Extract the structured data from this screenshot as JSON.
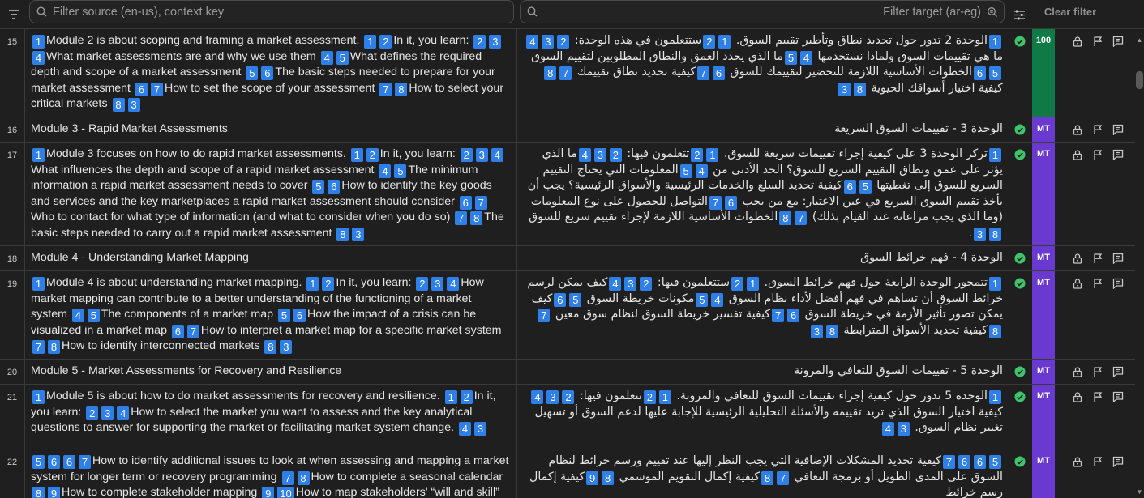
{
  "toolbar": {
    "source_filter_placeholder": "Filter source (en-us), context key",
    "target_filter_placeholder": "Filter target (ar-eg)",
    "clear_filter_label": "Clear filter"
  },
  "colors": {
    "tag": "#2f7fe8",
    "check": "#3ec56b",
    "badge_100": "#0f7a46",
    "badge_mt": "#6a3ad0"
  },
  "rows": [
    {
      "num": "15",
      "badge": "100",
      "source": [
        {
          "g": "1"
        },
        {
          "t": "Module 2 is about scoping and framing a market assessment. "
        },
        {
          "g": "1"
        },
        {
          "g": "2"
        },
        {
          "t": "In it, you learn: "
        },
        {
          "g": "2"
        },
        {
          "g": "3"
        },
        {
          "g": "4"
        },
        {
          "t": "What market assessments are and why we use them "
        },
        {
          "g": "4"
        },
        {
          "g": "5"
        },
        {
          "t": "What defines the required depth and scope of a market assessment "
        },
        {
          "g": "5"
        },
        {
          "g": "6"
        },
        {
          "t": "The basic steps needed to prepare for your market assessment  "
        },
        {
          "g": "6"
        },
        {
          "g": "7"
        },
        {
          "t": "How to set the scope of your assessment "
        },
        {
          "g": "7"
        },
        {
          "g": "8"
        },
        {
          "t": "How to select your critical markets  "
        },
        {
          "g": "8"
        },
        {
          "g": "3"
        }
      ],
      "target": [
        {
          "g": "1"
        },
        {
          "t": "الوحدة 2 تدور حول تحديد نطاق وتأطير تقييم السوق. "
        },
        {
          "g": "1"
        },
        {
          "g": "2"
        },
        {
          "t": "ستتعلمون في هذه الوحدة: "
        },
        {
          "g": "2"
        },
        {
          "g": "3"
        },
        {
          "g": "4"
        },
        {
          "t": "ما هي تقييمات السوق ولماذا نستخدمها "
        },
        {
          "g": "4"
        },
        {
          "g": "5"
        },
        {
          "t": "ما الذي يحدد العمق والنطاق المطلوبين لتقييم السوق "
        },
        {
          "g": "5"
        },
        {
          "g": "6"
        },
        {
          "t": "الخطوات الأساسية اللازمة للتحضير لتقييمك للسوق "
        },
        {
          "g": "6"
        },
        {
          "g": "7"
        },
        {
          "t": "كيفية تحديد نطاق تقييمك "
        },
        {
          "g": "7"
        },
        {
          "g": "8"
        },
        {
          "t": "كيفية اختيار أسواقك الحيوية "
        },
        {
          "g": "8"
        },
        {
          "g": "3"
        }
      ]
    },
    {
      "num": "16",
      "badge": "MT",
      "source": [
        {
          "t": "Module 3 - Rapid Market Assessments"
        }
      ],
      "target": [
        {
          "t": "الوحدة 3 - تقييمات السوق السريعة"
        }
      ]
    },
    {
      "num": "17",
      "badge": "MT",
      "source": [
        {
          "g": "1"
        },
        {
          "t": "Module 3 focuses on how to do rapid market assessments. "
        },
        {
          "g": "1"
        },
        {
          "g": "2"
        },
        {
          "t": "In it, you learn: "
        },
        {
          "g": "2"
        },
        {
          "g": "3"
        },
        {
          "g": "4"
        },
        {
          "t": "What influences the depth and scope of a rapid market assessment  "
        },
        {
          "g": "4"
        },
        {
          "g": "5"
        },
        {
          "t": "The minimum information a rapid market assessment needs to cover  "
        },
        {
          "g": "5"
        },
        {
          "g": "6"
        },
        {
          "t": "How to identify the key goods and services and the key marketplaces a rapid market assessment should consider  "
        },
        {
          "g": "6"
        },
        {
          "g": "7"
        },
        {
          "t": "Who to contact for what type of information (and what to consider when you do so) "
        },
        {
          "g": "7"
        },
        {
          "g": "8"
        },
        {
          "t": "The basic steps needed to carry out a rapid market assessment  "
        },
        {
          "g": "8"
        },
        {
          "g": "3"
        }
      ],
      "target": [
        {
          "g": "1"
        },
        {
          "t": "تركز الوحدة 3 على كيفية إجراء تقييمات سريعة للسوق. "
        },
        {
          "g": "1"
        },
        {
          "g": "2"
        },
        {
          "t": "تتعلمون فيها: "
        },
        {
          "g": "2"
        },
        {
          "g": "3"
        },
        {
          "g": "4"
        },
        {
          "t": "ما الذي يؤثر على عمق ونطاق التقييم السريع للسوق؟ "
        },
        {
          "t": "الحد الأدنى من "
        },
        {
          "g": "4"
        },
        {
          "g": "5"
        },
        {
          "t": "المعلومات التي يحتاج التقييم السريع للسوق إلى تغطيتها "
        },
        {
          "g": "5"
        },
        {
          "g": "6"
        },
        {
          "t": "كيفية تحديد السلع والخدمات الرئيسية والأسواق الرئيسية؟ يجب أن يأخذ تقييم السوق السريع في عين الاعتبار: مع من يجب "
        },
        {
          "g": "6"
        },
        {
          "g": "7"
        },
        {
          "t": "التواصل للحصول على نوع المعلومات (وما الذي يجب مراعاته عند القيام بذلك) "
        },
        {
          "g": "7"
        },
        {
          "g": "8"
        },
        {
          "t": "الخطوات الأساسية اللازمة لإجراء تقييم سريع للسوق "
        },
        {
          "g": "8"
        },
        {
          "g": "3"
        },
        {
          "t": "."
        }
      ]
    },
    {
      "num": "18",
      "badge": "MT",
      "source": [
        {
          "t": "Module 4 - Understanding Market Mapping"
        }
      ],
      "target": [
        {
          "t": "الوحدة 4 - فهم خرائط السوق"
        }
      ]
    },
    {
      "num": "19",
      "badge": "MT",
      "source": [
        {
          "g": "1"
        },
        {
          "t": "Module 4 is about understanding market mapping. "
        },
        {
          "g": "1"
        },
        {
          "g": "2"
        },
        {
          "t": "In it, you learn: "
        },
        {
          "g": "2"
        },
        {
          "g": "3"
        },
        {
          "g": "4"
        },
        {
          "t": "How market mapping can contribute to a better understanding of the functioning of a market system "
        },
        {
          "g": "4"
        },
        {
          "g": "5"
        },
        {
          "t": "The components of a market map  "
        },
        {
          "g": "5"
        },
        {
          "g": "6"
        },
        {
          "t": "How the impact of a crisis can be visualized in a market map  "
        },
        {
          "g": "6"
        },
        {
          "g": "7"
        },
        {
          "t": "How to interpret a market map for a specific market system  "
        },
        {
          "g": "7"
        },
        {
          "g": "8"
        },
        {
          "t": "How to identify interconnected markets "
        },
        {
          "g": "8"
        },
        {
          "g": "3"
        }
      ],
      "target": [
        {
          "g": "1"
        },
        {
          "t": "تتمحور الوحدة الرابعة حول فهم خرائط السوق. "
        },
        {
          "g": "1"
        },
        {
          "g": "2"
        },
        {
          "t": "ستتعلمون فيها: "
        },
        {
          "g": "2"
        },
        {
          "g": "3"
        },
        {
          "g": "4"
        },
        {
          "t": "كيف يمكن لرسم خرائط السوق أن تساهم في فهم أفضل لأداء نظام السوق "
        },
        {
          "g": "4"
        },
        {
          "g": "5"
        },
        {
          "t": "مكونات خريطة السوق "
        },
        {
          "g": "5"
        },
        {
          "g": "6"
        },
        {
          "t": "كيف يمكن تصور تأثير الأزمة في خريطة السوق "
        },
        {
          "g": "6"
        },
        {
          "g": "7"
        },
        {
          "t": "كيفية تفسير خريطة السوق لنظام سوق معين "
        },
        {
          "g": "7"
        },
        {
          "g": "8"
        },
        {
          "t": "كيفية تحديد الأسواق المترابطة "
        },
        {
          "g": "8"
        },
        {
          "g": "3"
        }
      ]
    },
    {
      "num": "20",
      "badge": "MT",
      "source": [
        {
          "t": "Module 5 - Market Assessments for Recovery and Resilience"
        }
      ],
      "target": [
        {
          "t": "الوحدة 5 - تقييمات السوق للتعافي والمرونة"
        }
      ]
    },
    {
      "num": "21",
      "badge": "MT",
      "source": [
        {
          "g": "1"
        },
        {
          "t": "Module 5 is about how to do market assessments for recovery and resilience. "
        },
        {
          "g": "1"
        },
        {
          "g": "2"
        },
        {
          "t": "In it, you learn: "
        },
        {
          "g": "2"
        },
        {
          "g": "3"
        },
        {
          "g": "4"
        },
        {
          "t": "How to select the market you want to assess and the key analytical questions to answer for supporting the market or facilitating market system change. "
        },
        {
          "g": "4"
        },
        {
          "g": "3"
        }
      ],
      "target": [
        {
          "g": "1"
        },
        {
          "t": "الوحدة 5 تدور حول كيفية إجراء تقييمات السوق للتعافي والمرونة. "
        },
        {
          "g": "1"
        },
        {
          "g": "2"
        },
        {
          "t": "تتعلمون فيها: "
        },
        {
          "g": "2"
        },
        {
          "g": "3"
        },
        {
          "g": "4"
        },
        {
          "t": "كيفية اختيار السوق الذي تريد تقييمه والأسئلة التحليلية الرئيسية للإجابة عليها لدعم السوق أو تسهيل تغيير نظام السوق. "
        },
        {
          "g": "3"
        },
        {
          "g": "4"
        }
      ]
    },
    {
      "num": "22",
      "badge": "MT",
      "source": [
        {
          "g": "5"
        },
        {
          "g": "6"
        },
        {
          "g": "6"
        },
        {
          "g": "7"
        },
        {
          "t": "How to identify additional issues to look at when assessing and mapping a market system for longer term or recovery programming "
        },
        {
          "g": "7"
        },
        {
          "g": "8"
        },
        {
          "t": "How to complete a seasonal calendar "
        },
        {
          "g": "8"
        },
        {
          "g": "9"
        },
        {
          "t": "How to complete stakeholder mapping  "
        },
        {
          "g": "9"
        },
        {
          "g": "10"
        },
        {
          "t": "How to map stakeholders' “will and skill”"
        }
      ],
      "target": [
        {
          "g": "5"
        },
        {
          "g": "6"
        },
        {
          "g": "6"
        },
        {
          "g": "7"
        },
        {
          "t": "كيفية تحديد المشكلات الإضافية التي يجب النظر إليها عند تقييم ورسم خرائط لنظام السوق على المدى الطويل أو برمجة التعافي "
        },
        {
          "g": "7"
        },
        {
          "g": "8"
        },
        {
          "t": "كيفية إكمال التقويم الموسمي "
        },
        {
          "g": "8"
        },
        {
          "g": "9"
        },
        {
          "t": "كيفية إكمال رسم خرائط"
        }
      ]
    }
  ]
}
